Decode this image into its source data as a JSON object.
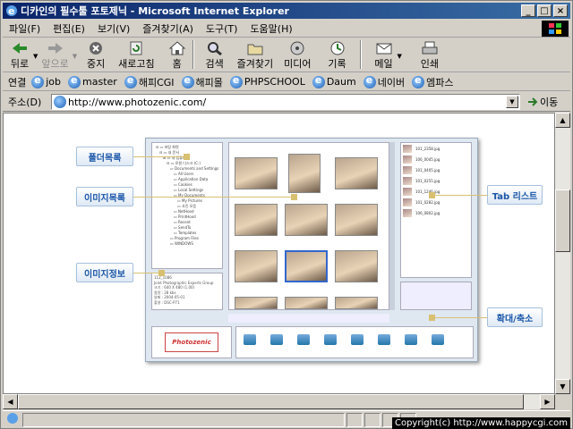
{
  "window": {
    "title": "디카인의 필수툴 포토제닉 - Microsoft Internet Explorer"
  },
  "menu": [
    "파일(F)",
    "편집(E)",
    "보기(V)",
    "즐겨찾기(A)",
    "도구(T)",
    "도움말(H)"
  ],
  "toolbar": {
    "back": "뒤로",
    "forward": "앞으로",
    "stop": "중지",
    "refresh": "새로고침",
    "home": "홈",
    "search": "검색",
    "favorites": "즐겨찾기",
    "media": "미디어",
    "history": "기록",
    "mail": "메일",
    "print": "인쇄"
  },
  "links": {
    "label": "연결",
    "items": [
      "job",
      "master",
      "해피CGI",
      "해피몰",
      "PHPSCHOOL",
      "Daum",
      "네이버",
      "엠파스"
    ]
  },
  "address": {
    "label": "주소(D)",
    "url": "http://www.photozenic.com/",
    "go": "이동"
  },
  "callouts": {
    "folder": "폴더목록",
    "image_list": "이미지목록",
    "image_info": "이미지정보",
    "tab_list": "Tab 리스트",
    "zoom": "확대/축소"
  },
  "screenshot_text": {
    "logo": "Photozenic",
    "tab_files": [
      "101_2358.jpg",
      "106_0045.jpg",
      "101_0405.jpg",
      "101_0255.jpg",
      "101_1246.jpg",
      "101_0282.jpg",
      "106_0802.jpg"
    ]
  },
  "status": {
    "copyright": "Copyright(c) http://www.happycgi.com"
  }
}
